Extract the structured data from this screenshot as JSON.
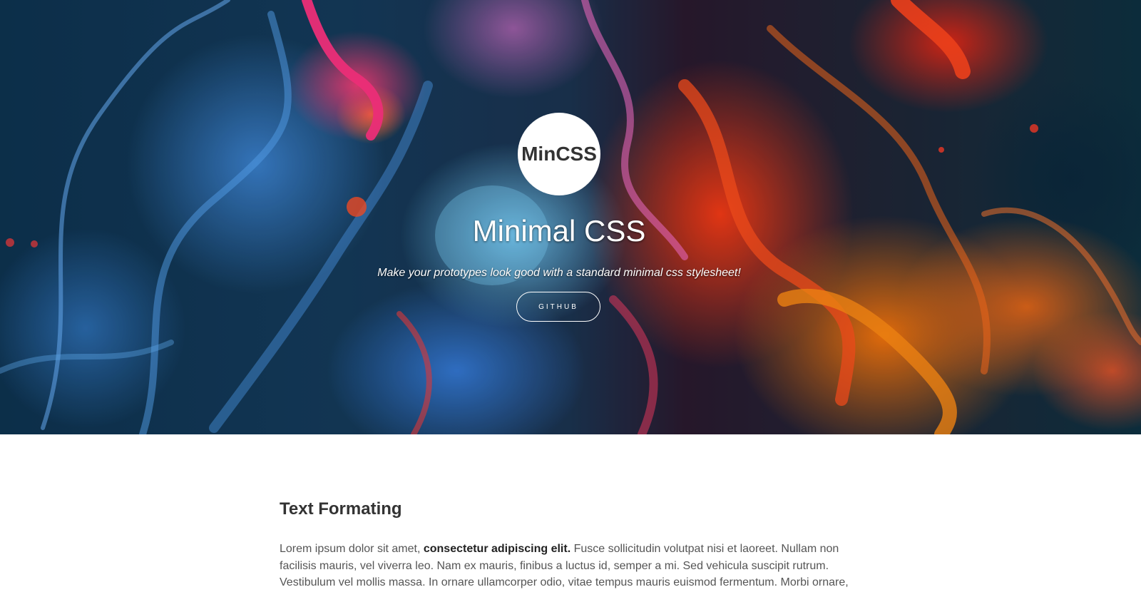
{
  "hero": {
    "logo_text": "MinCSS",
    "title": "Minimal CSS",
    "subtitle": "Make your prototypes look good with a standard minimal css stylesheet!",
    "button_label": "GITHUB"
  },
  "content": {
    "heading": "Text Formating",
    "paragraph": {
      "lead": "Lorem ipsum dolor sit amet, ",
      "bold": "consectetur adipiscing elit.",
      "rest": " Fusce sollicitudin volutpat nisi et laoreet. Nullam non facilisis mauris, vel viverra leo. Nam ex mauris, finibus a luctus id, semper a mi. Sed vehicula suscipit rutrum. Vestibulum vel mollis massa. In ornare ullamcorper odio, vitae tempus mauris euismod fermentum. Morbi ornare,"
    }
  },
  "colors": {
    "heading": "#333333",
    "text": "#555555",
    "hero_text": "#ffffff",
    "ink_blue": "#3c8ce6",
    "ink_orange": "#ff6a14",
    "ink_red": "#f03c28"
  }
}
